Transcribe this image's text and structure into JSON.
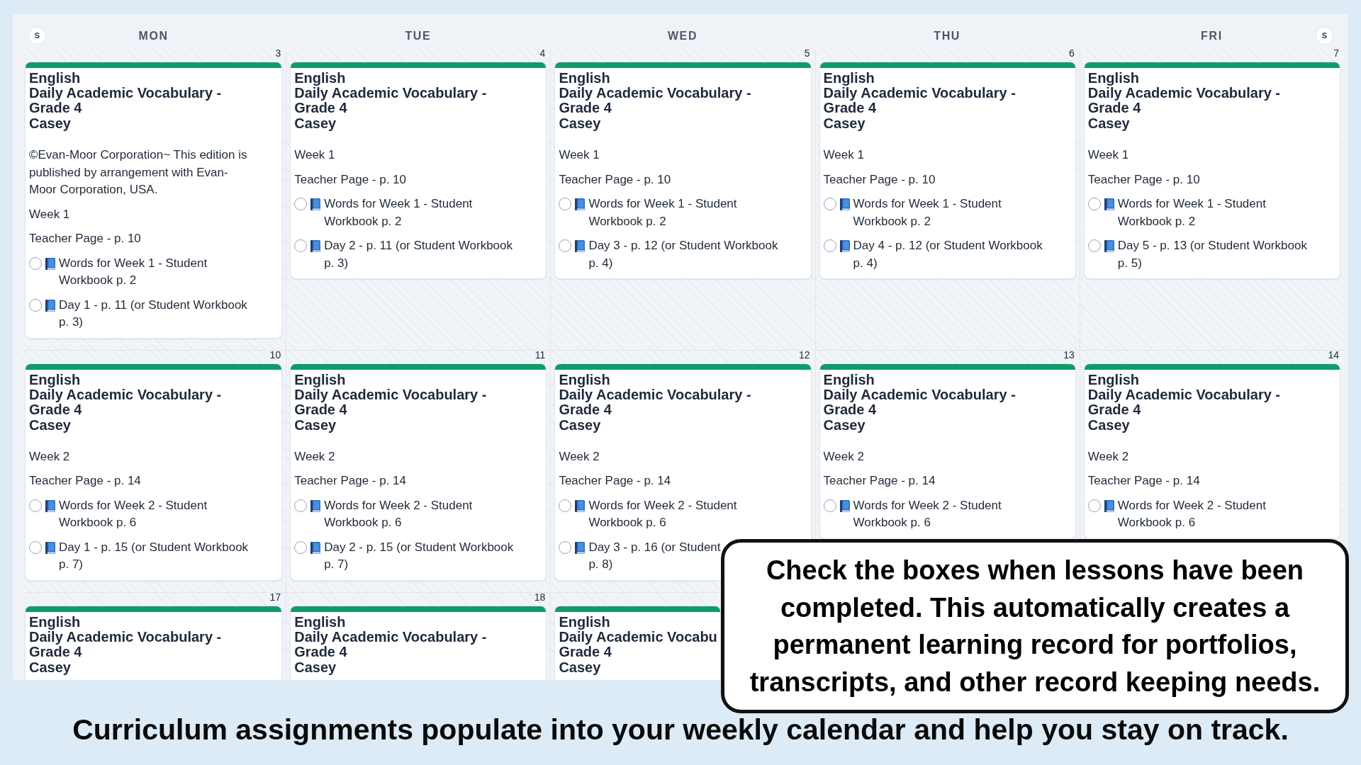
{
  "calendar": {
    "header": {
      "leading_toggle": "S",
      "days": [
        "MON",
        "TUE",
        "WED",
        "THU",
        "FRI"
      ],
      "trailing_toggle": "S"
    },
    "weeks": [
      {
        "days": [
          {
            "date": "3",
            "events": [
              {
                "subject": "English",
                "title": "Daily Academic Vocabulary - Grade 4",
                "student": "Casey",
                "lines": [
                  "©Evan-Moor Corporation~ This edition is published by arrangement with Evan-Moor Corporation, USA.",
                  "Week 1",
                  "Teacher Page - p. 10"
                ],
                "tasks": [
                  {
                    "checked": false,
                    "text": "Words for Week 1 - Student Workbook p. 2"
                  },
                  {
                    "checked": false,
                    "text": "Day 1 - p. 11 (or Student Workbook p. 3)"
                  }
                ]
              }
            ]
          },
          {
            "date": "4",
            "events": [
              {
                "subject": "English",
                "title": "Daily Academic Vocabulary - Grade 4",
                "student": "Casey",
                "lines": [
                  "Week 1",
                  "Teacher Page - p. 10"
                ],
                "tasks": [
                  {
                    "checked": false,
                    "text": "Words for Week 1 - Student Workbook p. 2"
                  },
                  {
                    "checked": false,
                    "text": "Day 2 - p. 11 (or Student Workbook p. 3)"
                  }
                ]
              }
            ]
          },
          {
            "date": "5",
            "events": [
              {
                "subject": "English",
                "title": "Daily Academic Vocabulary - Grade 4",
                "student": "Casey",
                "lines": [
                  "Week 1",
                  "Teacher Page - p. 10"
                ],
                "tasks": [
                  {
                    "checked": false,
                    "text": "Words for Week 1 - Student Workbook p. 2"
                  },
                  {
                    "checked": false,
                    "text": "Day 3 - p. 12 (or Student Workbook p. 4)"
                  }
                ]
              }
            ]
          },
          {
            "date": "6",
            "events": [
              {
                "subject": "English",
                "title": "Daily Academic Vocabulary - Grade 4",
                "student": "Casey",
                "lines": [
                  "Week 1",
                  "Teacher Page - p. 10"
                ],
                "tasks": [
                  {
                    "checked": false,
                    "text": "Words for Week 1 - Student Workbook p. 2"
                  },
                  {
                    "checked": false,
                    "text": "Day 4 - p. 12 (or Student Workbook p. 4)"
                  }
                ]
              }
            ]
          },
          {
            "date": "7",
            "events": [
              {
                "subject": "English",
                "title": "Daily Academic Vocabulary - Grade 4",
                "student": "Casey",
                "lines": [
                  "Week 1",
                  "Teacher Page - p. 10"
                ],
                "tasks": [
                  {
                    "checked": false,
                    "text": "Words for Week 1 - Student Workbook p. 2"
                  },
                  {
                    "checked": false,
                    "text": "Day 5 - p. 13 (or Student Workbook p. 5)"
                  }
                ]
              }
            ]
          }
        ]
      },
      {
        "days": [
          {
            "date": "10",
            "events": [
              {
                "subject": "English",
                "title": "Daily Academic Vocabulary - Grade 4",
                "student": "Casey",
                "lines": [
                  "Week 2",
                  "Teacher Page - p. 14"
                ],
                "tasks": [
                  {
                    "checked": false,
                    "text": "Words for Week 2 - Student Workbook p. 6"
                  },
                  {
                    "checked": false,
                    "text": "Day 1 - p. 15 (or Student Workbook p. 7)"
                  }
                ]
              }
            ]
          },
          {
            "date": "11",
            "events": [
              {
                "subject": "English",
                "title": "Daily Academic Vocabulary - Grade 4",
                "student": "Casey",
                "lines": [
                  "Week 2",
                  "Teacher Page - p. 14"
                ],
                "tasks": [
                  {
                    "checked": false,
                    "text": "Words for Week 2 - Student Workbook p. 6"
                  },
                  {
                    "checked": false,
                    "text": "Day 2 - p. 15 (or Student Workbook p. 7)"
                  }
                ]
              }
            ]
          },
          {
            "date": "12",
            "events": [
              {
                "subject": "English",
                "title": "Daily Academic Vocabulary - Grade 4",
                "student": "Casey",
                "lines": [
                  "Week 2",
                  "Teacher Page - p. 14"
                ],
                "tasks": [
                  {
                    "checked": false,
                    "text": "Words for Week 2 - Student Workbook p. 6"
                  },
                  {
                    "checked": false,
                    "text": "Day 3 - p. 16 (or Student",
                    "second_line": "p. 8)"
                  }
                ]
              }
            ]
          },
          {
            "date": "13",
            "events": [
              {
                "subject": "English",
                "title": "Daily Academic Vocabulary - Grade 4",
                "student": "Casey",
                "lines": [
                  "Week 2",
                  "Teacher Page - p. 14"
                ],
                "tasks": [
                  {
                    "checked": false,
                    "text": "Words for Week 2 - Student Workbook p. 6"
                  }
                ]
              }
            ]
          },
          {
            "date": "14",
            "events": [
              {
                "subject": "English",
                "title": "Daily Academic Vocabulary - Grade 4",
                "student": "Casey",
                "lines": [
                  "Week 2",
                  "Teacher Page - p. 14"
                ],
                "tasks": [
                  {
                    "checked": false,
                    "text": "Words for Week 2 - Student Workbook p. 6"
                  }
                ]
              }
            ]
          }
        ]
      },
      {
        "days": [
          {
            "date": "17",
            "events": [
              {
                "subject": "English",
                "title": "Daily Academic Vocabulary - Grade 4",
                "student": "Casey"
              }
            ]
          },
          {
            "date": "18",
            "events": [
              {
                "subject": "English",
                "title": "Daily Academic Vocabulary - Grade 4",
                "student": "Casey"
              }
            ]
          },
          {
            "events": [
              {
                "subject": "English",
                "title": "Daily Academic Vocabu",
                "title_second_line": "Grade 4",
                "student": "Casey"
              }
            ]
          }
        ]
      }
    ]
  },
  "callout": {
    "text": "Check the boxes when lessons have been completed. This automatically creates a permanent learning record for portfolios, transcripts, and other record keeping needs."
  },
  "caption": "Curriculum assignments populate into your weekly calendar and help you stay on track."
}
